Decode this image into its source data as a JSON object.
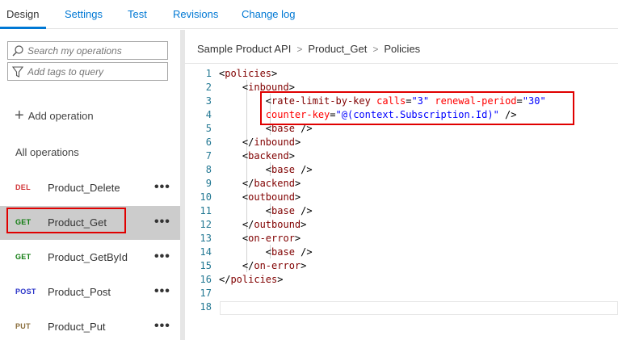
{
  "tabs": [
    {
      "label": "Design",
      "active": true
    },
    {
      "label": "Settings",
      "active": false
    },
    {
      "label": "Test",
      "active": false
    },
    {
      "label": "Revisions",
      "active": false
    },
    {
      "label": "Change log",
      "active": false
    }
  ],
  "sidebar": {
    "search": {
      "placeholder": "Search my operations",
      "value": "",
      "icon": "search-icon"
    },
    "tags": {
      "placeholder": "Add tags to query",
      "value": "",
      "icon": "filter-icon"
    },
    "add_operation": "Add operation",
    "all_operations": "All operations",
    "operations": [
      {
        "method": "DEL",
        "name": "Product_Delete",
        "more": "•••",
        "selected": false
      },
      {
        "method": "GET",
        "name": "Product_Get",
        "more": "•••",
        "selected": true
      },
      {
        "method": "GET",
        "name": "Product_GetById",
        "more": "•••",
        "selected": false
      },
      {
        "method": "POST",
        "name": "Product_Post",
        "more": "•••",
        "selected": false
      },
      {
        "method": "PUT",
        "name": "Product_Put",
        "more": "•••",
        "selected": false
      }
    ]
  },
  "breadcrumb": [
    "Sample Product API",
    "Product_Get",
    "Policies"
  ],
  "editor": {
    "line_numbers": [
      "1",
      "2",
      "3",
      "4",
      "5",
      "6",
      "7",
      "8",
      "9",
      "10",
      "11",
      "12",
      "13",
      "14",
      "15",
      "16",
      "17",
      "18"
    ],
    "lines": [
      [
        {
          "c": "p",
          "t": "<"
        },
        {
          "c": "t",
          "t": "policies"
        },
        {
          "c": "p",
          "t": ">"
        }
      ],
      [
        {
          "c": "p",
          "t": "    <"
        },
        {
          "c": "t",
          "t": "inbound"
        },
        {
          "c": "p",
          "t": ">"
        }
      ],
      [
        {
          "c": "p",
          "t": "        <"
        },
        {
          "c": "t",
          "t": "rate-limit-by-key"
        },
        {
          "c": "p",
          "t": " "
        },
        {
          "c": "a",
          "t": "calls"
        },
        {
          "c": "p",
          "t": "="
        },
        {
          "c": "v",
          "t": "\"3\""
        },
        {
          "c": "p",
          "t": " "
        },
        {
          "c": "a",
          "t": "renewal-period"
        },
        {
          "c": "p",
          "t": "="
        },
        {
          "c": "v",
          "t": "\"30\""
        }
      ],
      [
        {
          "c": "p",
          "t": "        "
        },
        {
          "c": "a",
          "t": "counter-key"
        },
        {
          "c": "p",
          "t": "="
        },
        {
          "c": "v",
          "t": "\"@(context.Subscription.Id)\""
        },
        {
          "c": "p",
          "t": " />"
        }
      ],
      [
        {
          "c": "p",
          "t": "        <"
        },
        {
          "c": "t",
          "t": "base"
        },
        {
          "c": "p",
          "t": " />"
        }
      ],
      [
        {
          "c": "p",
          "t": "    </"
        },
        {
          "c": "t",
          "t": "inbound"
        },
        {
          "c": "p",
          "t": ">"
        }
      ],
      [
        {
          "c": "p",
          "t": "    <"
        },
        {
          "c": "t",
          "t": "backend"
        },
        {
          "c": "p",
          "t": ">"
        }
      ],
      [
        {
          "c": "p",
          "t": "        <"
        },
        {
          "c": "t",
          "t": "base"
        },
        {
          "c": "p",
          "t": " />"
        }
      ],
      [
        {
          "c": "p",
          "t": "    </"
        },
        {
          "c": "t",
          "t": "backend"
        },
        {
          "c": "p",
          "t": ">"
        }
      ],
      [
        {
          "c": "p",
          "t": "    <"
        },
        {
          "c": "t",
          "t": "outbound"
        },
        {
          "c": "p",
          "t": ">"
        }
      ],
      [
        {
          "c": "p",
          "t": "        <"
        },
        {
          "c": "t",
          "t": "base"
        },
        {
          "c": "p",
          "t": " />"
        }
      ],
      [
        {
          "c": "p",
          "t": "    </"
        },
        {
          "c": "t",
          "t": "outbound"
        },
        {
          "c": "p",
          "t": ">"
        }
      ],
      [
        {
          "c": "p",
          "t": "    <"
        },
        {
          "c": "t",
          "t": "on-error"
        },
        {
          "c": "p",
          "t": ">"
        }
      ],
      [
        {
          "c": "p",
          "t": "        <"
        },
        {
          "c": "t",
          "t": "base"
        },
        {
          "c": "p",
          "t": " />"
        }
      ],
      [
        {
          "c": "p",
          "t": "    </"
        },
        {
          "c": "t",
          "t": "on-error"
        },
        {
          "c": "p",
          "t": ">"
        }
      ],
      [
        {
          "c": "p",
          "t": "</"
        },
        {
          "c": "t",
          "t": "policies"
        },
        {
          "c": "p",
          "t": ">"
        }
      ],
      [],
      []
    ]
  },
  "colors": {
    "accent": "#0078d4",
    "highlight": "#e00000",
    "selected_bg": "#cccccc"
  }
}
